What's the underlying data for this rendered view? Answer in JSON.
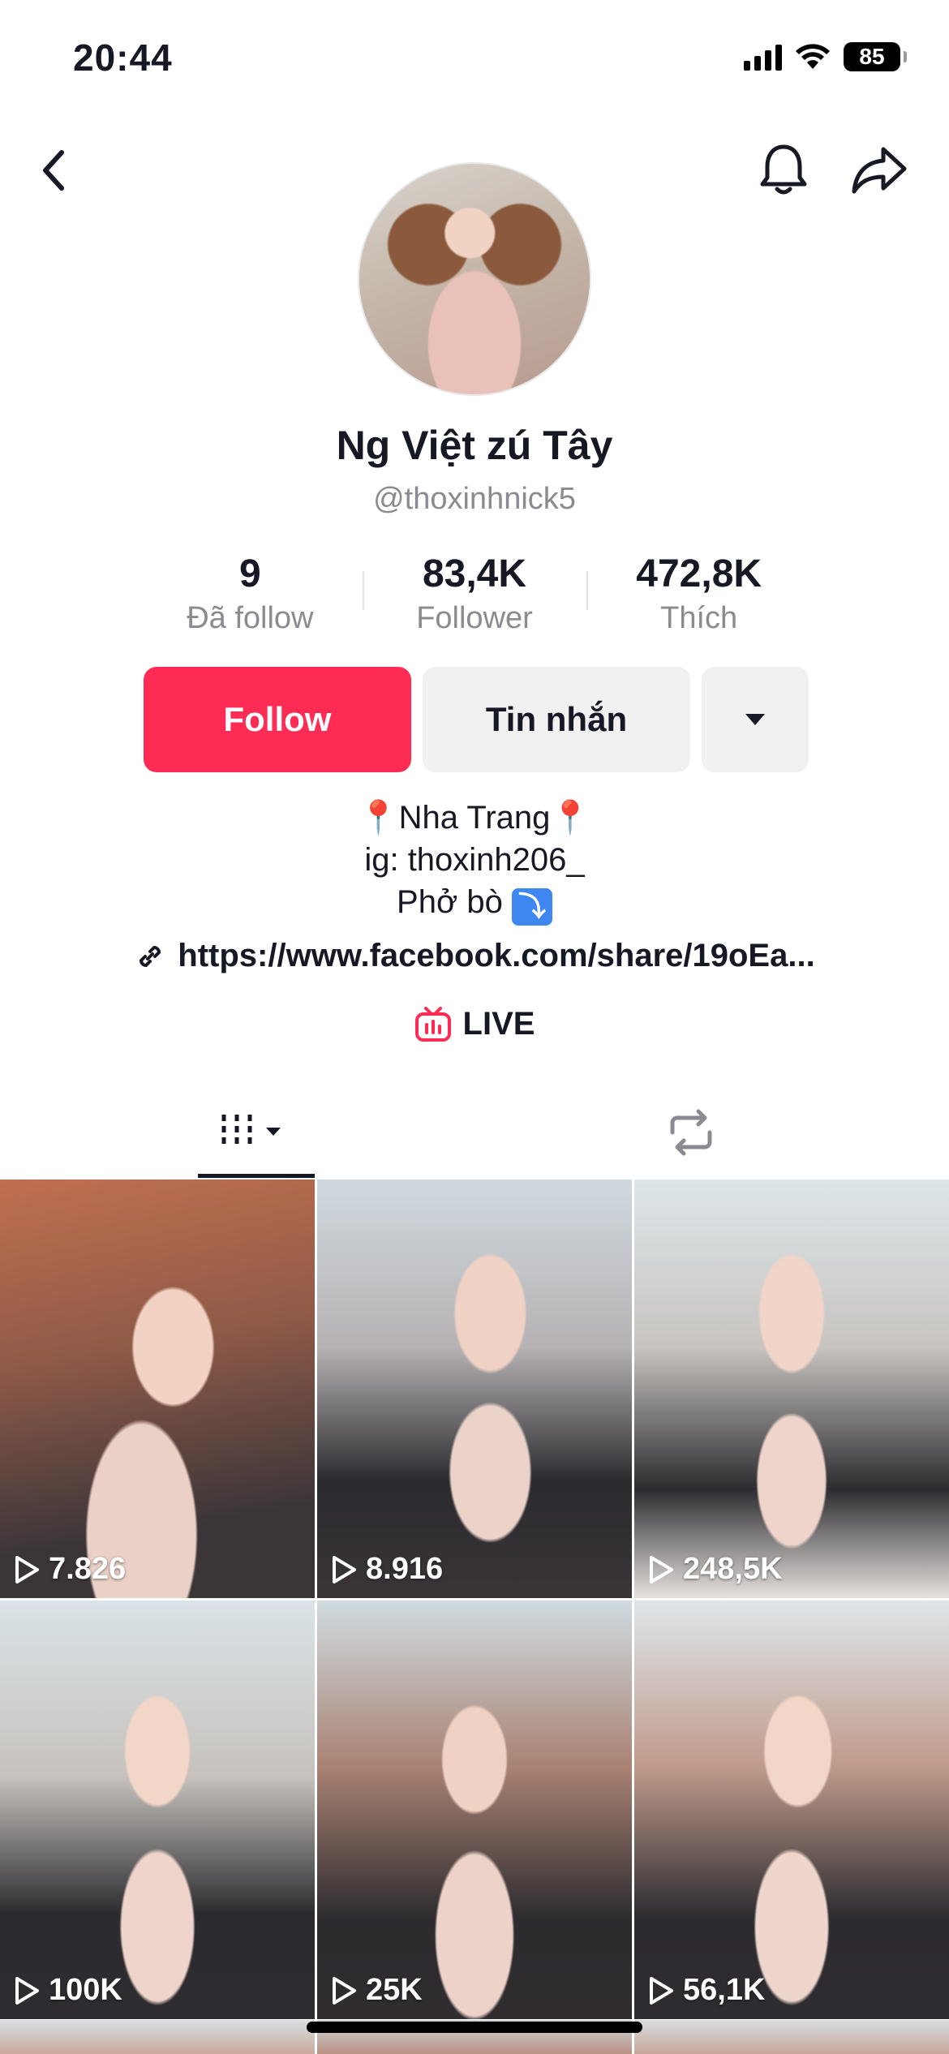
{
  "status_bar": {
    "time": "20:44",
    "battery": "85"
  },
  "profile": {
    "display_name": "Ng Việt zú Tây",
    "username": "@thoxinhnick5"
  },
  "stats": [
    {
      "value": "9",
      "label": "Đã follow"
    },
    {
      "value": "83,4K",
      "label": "Follower"
    },
    {
      "value": "472,8K",
      "label": "Thích"
    }
  ],
  "actions": {
    "follow_label": "Follow",
    "message_label": "Tin nhắn"
  },
  "bio": {
    "line1": "Nha Trang",
    "line2": "ig: thoxinh206_",
    "line3": "Phở bò",
    "link": "https://www.facebook.com/share/19oEa...",
    "live_label": "LIVE"
  },
  "videos": [
    {
      "views": "7.826"
    },
    {
      "views": "8.916"
    },
    {
      "views": "248,5K"
    },
    {
      "views": "100K"
    },
    {
      "views": "25K"
    },
    {
      "views": "56,1K"
    }
  ],
  "colors": {
    "accent": "#fe2c55",
    "text": "#161823",
    "muted": "#8a8b91",
    "button_bg": "#f1f1f2"
  }
}
